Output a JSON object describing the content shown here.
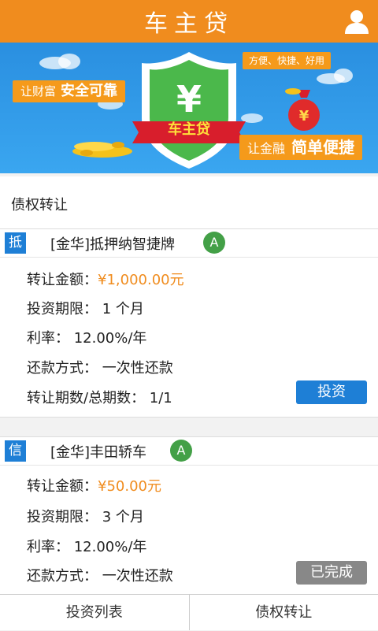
{
  "header": {
    "title": "车主贷"
  },
  "banner": {
    "tag_left_small": "让财富",
    "tag_left_big": "安全可靠",
    "tag_top": "方便、快捷、好用",
    "tag_right_small": "让金融",
    "tag_right_big": "简单便捷",
    "ribbon": "车主贷",
    "shield_symbol": "¥",
    "bag_symbol": "¥"
  },
  "section": {
    "title": "债权转让"
  },
  "cards": [
    {
      "badge": "抵",
      "title": "[金华]抵押纳智捷牌",
      "grade": "A",
      "amount_label": "转让金额：",
      "amount_value": "¥1,000.00元",
      "period": "投资期限： 1 个月",
      "rate": "利率： 12.00%/年",
      "repay": "还款方式： 一次性还款",
      "installments": "转让期数/总期数： 1/1",
      "button": "投资"
    },
    {
      "badge": "信",
      "title": "[金华]丰田轿车",
      "grade": "A",
      "amount_label": "转让金额：",
      "amount_value": "¥50.00元",
      "period": "投资期限： 3 个月",
      "rate": "利率： 12.00%/年",
      "repay": "还款方式： 一次性还款",
      "button": "已完成"
    }
  ],
  "tabs": [
    {
      "label": "投资列表"
    },
    {
      "label": "债权转让"
    }
  ],
  "colors": {
    "brand": "#f08c1e",
    "accent": "#1e7fd6",
    "grade": "#43a047",
    "done": "#888888"
  }
}
